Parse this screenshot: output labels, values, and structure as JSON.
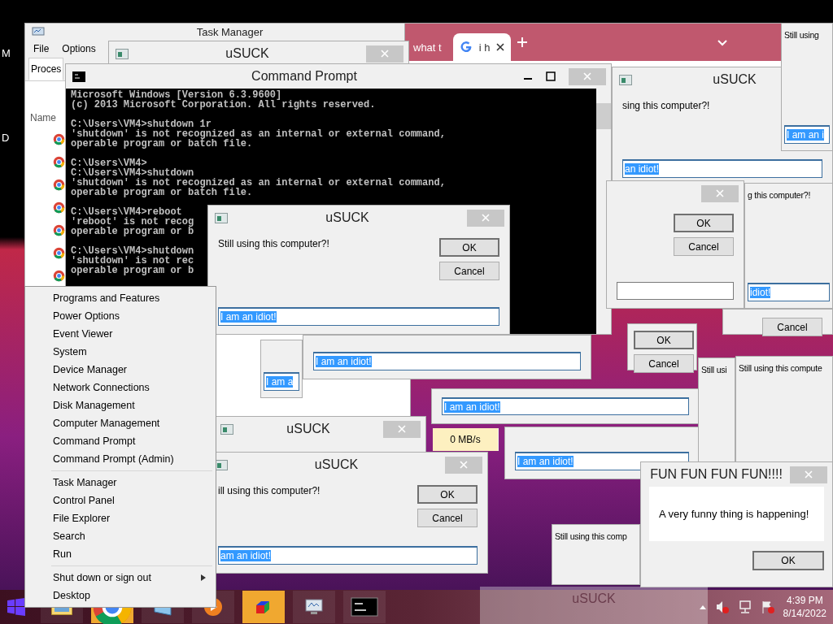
{
  "desktop_icons": [
    {
      "label": "M"
    },
    {
      "label": "D"
    }
  ],
  "windows": [
    {
      "kind": "task_manager",
      "title": "Task Manager",
      "menu": [
        "File",
        "Options"
      ],
      "tabs": [
        {
          "label": "Proces",
          "selected": true
        }
      ],
      "columns": [
        "Name"
      ]
    },
    {
      "kind": "browser",
      "tabs": [
        {
          "label": "what t",
          "selected": false
        },
        {
          "label": "i h",
          "selected": true
        }
      ]
    },
    {
      "kind": "dialog",
      "title": "uSUCK",
      "close": true
    },
    {
      "kind": "console",
      "title": "Command Prompt",
      "blocks": [
        [
          "Microsoft Windows [Version 6.3.9600]",
          "(c) 2013 Microsoft Corporation. All rights reserved."
        ],
        [
          "C:\\Users\\VM4>shutdown 1r",
          "'shutdown' is not recognized as an internal or external command,",
          "operable program or batch file."
        ],
        [
          "C:\\Users\\VM4>",
          "C:\\Users\\VM4>shutdown",
          "'shutdown' is not recognized as an internal or external command,",
          "operable program or batch file."
        ],
        [
          "C:\\Users\\VM4>reboot",
          "'reboot' is not recog",
          "operable program or b"
        ],
        [
          "C:\\Users\\VM4>shutdown",
          "'shutdown' is not rec",
          "operable program or b"
        ]
      ]
    },
    {
      "kind": "dialog",
      "title": "uSUCK",
      "message": "sing this computer?!",
      "input": {
        "value": "an idiot!",
        "selected": true
      }
    },
    {
      "kind": "dialog",
      "message": "Still using",
      "input": {
        "value": "I am an i",
        "selected": true
      }
    },
    {
      "kind": "dialog",
      "close": true,
      "buttons": [
        {
          "label": "OK",
          "default": true
        },
        {
          "label": "Cancel",
          "default": false
        }
      ],
      "input": {
        "selected": false
      }
    },
    {
      "kind": "dialog",
      "message": "g this computer?!",
      "input": {
        "value": "idiot!",
        "selected": true
      }
    },
    {
      "kind": "dialog",
      "title": "uSUCK",
      "close": true,
      "message": "Still using this computer?!",
      "buttons": [
        {
          "label": "OK",
          "default": true
        },
        {
          "label": "Cancel",
          "default": false
        }
      ],
      "input": {
        "value": "I am an idiot!",
        "selected": true
      }
    },
    {
      "kind": "dialog",
      "input": {
        "value": "I am a",
        "selected": true
      }
    },
    {
      "kind": "dialog",
      "input": {
        "value": "I am an idiot!",
        "selected": true
      }
    },
    {
      "kind": "dialog",
      "buttons": [
        {
          "label": "OK",
          "default": true
        },
        {
          "label": "Cancel",
          "default": false
        }
      ]
    },
    {
      "kind": "dialog",
      "buttons": [
        {
          "label": "Cancel",
          "default": false
        }
      ]
    },
    {
      "kind": "dialog",
      "input": {
        "value": "I am an idiot!",
        "selected": true
      }
    },
    {
      "kind": "dialog",
      "input": {
        "value": "I am an idiot!",
        "selected": true
      }
    },
    {
      "kind": "cell",
      "text": "0 MB/s"
    },
    {
      "kind": "dialog",
      "message": "Still usi"
    },
    {
      "kind": "dialog",
      "message": "Still using this compute"
    },
    {
      "kind": "dialog",
      "title": "uSUCK",
      "close": true
    },
    {
      "kind": "dialog",
      "title": "uSUCK",
      "close": true,
      "message": "ill using this computer?!",
      "buttons": [
        {
          "label": "OK",
          "default": true
        },
        {
          "label": "Cancel",
          "default": false
        }
      ],
      "input": {
        "value": "am an idiot!",
        "selected": true
      }
    },
    {
      "kind": "dialog",
      "message": "Still using this comp"
    },
    {
      "kind": "fun",
      "title": "FUN FUN FUN FUN!!!!",
      "message": "A very funny thing is happening!",
      "button": "OK"
    }
  ],
  "context_menu": {
    "groups": [
      [
        {
          "label": "Programs and Features",
          "submenu": false
        },
        {
          "label": "Power Options",
          "submenu": false
        },
        {
          "label": "Event Viewer",
          "submenu": false
        },
        {
          "label": "System",
          "submenu": false
        },
        {
          "label": "Device Manager",
          "submenu": false
        },
        {
          "label": "Network Connections",
          "submenu": false
        },
        {
          "label": "Disk Management",
          "submenu": false
        },
        {
          "label": "Computer Management",
          "submenu": false
        },
        {
          "label": "Command Prompt",
          "submenu": false
        },
        {
          "label": "Command Prompt (Admin)",
          "submenu": false
        }
      ],
      [
        {
          "label": "Task Manager",
          "submenu": false
        },
        {
          "label": "Control Panel",
          "submenu": false
        },
        {
          "label": "File Explorer",
          "submenu": false
        },
        {
          "label": "Search",
          "submenu": false
        },
        {
          "label": "Run",
          "submenu": false
        }
      ],
      [
        {
          "label": "Shut down or sign out",
          "submenu": true
        },
        {
          "label": "Desktop",
          "submenu": false
        }
      ]
    ]
  },
  "taskbar": {
    "apps": [
      {
        "kind": "explorer",
        "active": false
      },
      {
        "kind": "chrome",
        "active": true
      },
      {
        "kind": "window",
        "active": false
      },
      {
        "kind": "media",
        "active": false
      },
      {
        "kind": "cube",
        "active": true
      },
      {
        "kind": "monitor",
        "active": false
      },
      {
        "kind": "terminal",
        "active": false
      }
    ],
    "time": "4:39 PM",
    "date": "8/14/2022"
  },
  "ghost_window": {
    "title": "uSUCK"
  }
}
